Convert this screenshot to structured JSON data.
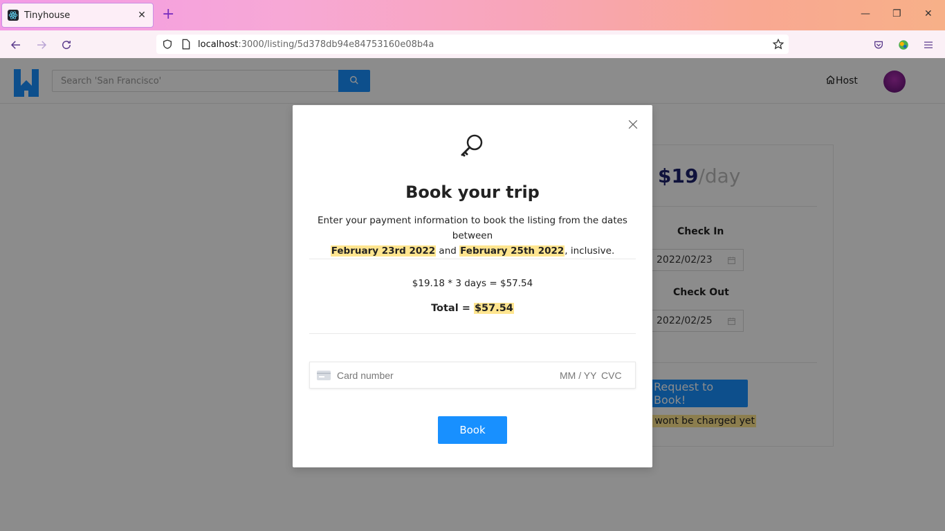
{
  "browser": {
    "tab_title": "Tinyhouse",
    "url_host": "localhost",
    "url_path": ":3000/listing/5d378db94e84753160e08b4a",
    "new_tab_symbol": "+"
  },
  "header": {
    "search_placeholder": "Search 'San Francisco'",
    "host_label": "Host"
  },
  "booking_card": {
    "price": "$19",
    "per": "/day",
    "check_in_label": "Check In",
    "check_in_value": "2022/02/23",
    "check_out_label": "Check Out",
    "check_out_value": "2022/02/25",
    "request_label": "Request to Book!",
    "note": "u wont be charged yet"
  },
  "modal": {
    "title": "Book your trip",
    "desc_prefix": "Enter your payment information to book the listing from the dates between",
    "date_from": "February 23rd 2022",
    "desc_and": "and",
    "date_to": "February 25th 2022",
    "desc_suffix": ", inclusive.",
    "calc_prefix": "$19.18 * 3 days = ",
    "calc_result": "$57.54",
    "total_label": "Total = ",
    "total_value": "$57.54",
    "card_placeholder": "Card number",
    "exp_placeholder": "MM / YY",
    "cvc_placeholder": "CVC",
    "book_label": "Book"
  },
  "colors": {
    "primary": "#1890ff",
    "highlight": "#ffe58f",
    "price": "#1d226c"
  },
  "icons": [
    "react-favicon",
    "back-arrow-icon",
    "forward-arrow-icon",
    "reload-icon",
    "shield-icon",
    "page-icon",
    "star-icon",
    "pocket-icon",
    "extension-icon",
    "menu-icon",
    "search-icon",
    "home-icon",
    "calendar-icon",
    "close-icon",
    "key-icon",
    "card-icon"
  ]
}
